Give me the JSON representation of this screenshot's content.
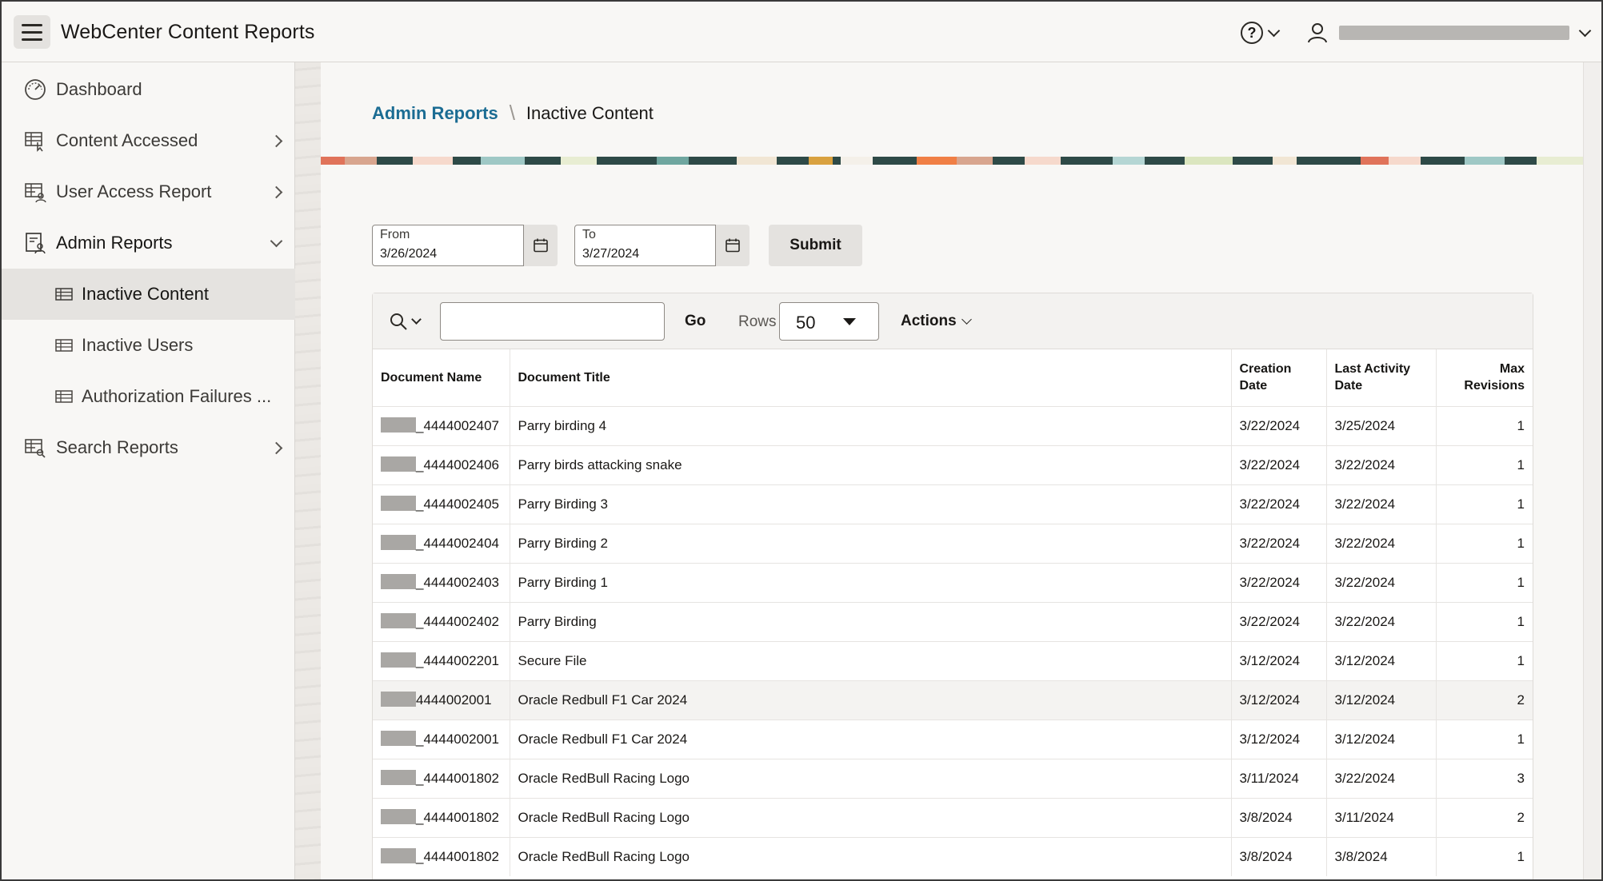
{
  "app": {
    "title": "WebCenter Content Reports"
  },
  "header": {
    "help_icon": "help-icon",
    "user_icon": "user-icon"
  },
  "sidebar": {
    "items": [
      {
        "label": "Dashboard",
        "icon": "dashboard-gauge-icon"
      },
      {
        "label": "Content Accessed",
        "icon": "content-accessed-report-icon"
      },
      {
        "label": "User Access Report",
        "icon": "user-access-report-icon"
      },
      {
        "label": "Admin Reports",
        "icon": "admin-reports-icon"
      },
      {
        "label": "Inactive Content",
        "icon": "table-icon"
      },
      {
        "label": "Inactive Users",
        "icon": "table-icon"
      },
      {
        "label": "Authorization Failures ...",
        "icon": "table-icon"
      },
      {
        "label": "Search Reports",
        "icon": "search-reports-icon"
      }
    ]
  },
  "breadcrumb": {
    "parent": "Admin Reports",
    "separator": "\\",
    "current": "Inactive Content"
  },
  "filters": {
    "from_label": "From",
    "from_value": "3/26/2024",
    "to_label": "To",
    "to_value": "3/27/2024",
    "submit_label": "Submit"
  },
  "toolbar": {
    "search_value": "",
    "go_label": "Go",
    "rows_label": "Rows",
    "rows_value": "50",
    "actions_label": "Actions"
  },
  "table": {
    "columns": [
      "Document Name",
      "Document Title",
      "Creation Date",
      "Last Activity Date",
      "Max Revisions"
    ],
    "rows": [
      {
        "name": "_4444002407",
        "title": "Parry birding 4",
        "created": "3/22/2024",
        "last_activity": "3/25/2024",
        "revisions": "1"
      },
      {
        "name": "_4444002406",
        "title": "Parry birds attacking snake",
        "created": "3/22/2024",
        "last_activity": "3/22/2024",
        "revisions": "1"
      },
      {
        "name": "_4444002405",
        "title": "Parry Birding 3",
        "created": "3/22/2024",
        "last_activity": "3/22/2024",
        "revisions": "1"
      },
      {
        "name": "_4444002404",
        "title": "Parry Birding 2",
        "created": "3/22/2024",
        "last_activity": "3/22/2024",
        "revisions": "1"
      },
      {
        "name": "_4444002403",
        "title": "Parry Birding 1",
        "created": "3/22/2024",
        "last_activity": "3/22/2024",
        "revisions": "1"
      },
      {
        "name": "_4444002402",
        "title": "Parry Birding",
        "created": "3/22/2024",
        "last_activity": "3/22/2024",
        "revisions": "1"
      },
      {
        "name": "_4444002201",
        "title": "Secure File",
        "created": "3/12/2024",
        "last_activity": "3/12/2024",
        "revisions": "1"
      },
      {
        "name": "4444002001",
        "title": "Oracle Redbull F1 Car 2024",
        "created": "3/12/2024",
        "last_activity": "3/12/2024",
        "revisions": "2"
      },
      {
        "name": "_4444002001",
        "title": "Oracle Redbull F1 Car 2024",
        "created": "3/12/2024",
        "last_activity": "3/12/2024",
        "revisions": "1"
      },
      {
        "name": "_4444001802",
        "title": "Oracle RedBull Racing Logo",
        "created": "3/11/2024",
        "last_activity": "3/22/2024",
        "revisions": "3"
      },
      {
        "name": "_4444001802",
        "title": "Oracle RedBull Racing Logo",
        "created": "3/8/2024",
        "last_activity": "3/11/2024",
        "revisions": "2"
      },
      {
        "name": "_4444001802",
        "title": "Oracle RedBull Racing Logo",
        "created": "3/8/2024",
        "last_activity": "3/8/2024",
        "revisions": "1"
      }
    ],
    "highlighted_row": 7
  },
  "colors": {
    "accent_link": "#1b6c93",
    "selected_nav": "#e5e3e0",
    "header_bg": "#f8f7f5"
  }
}
